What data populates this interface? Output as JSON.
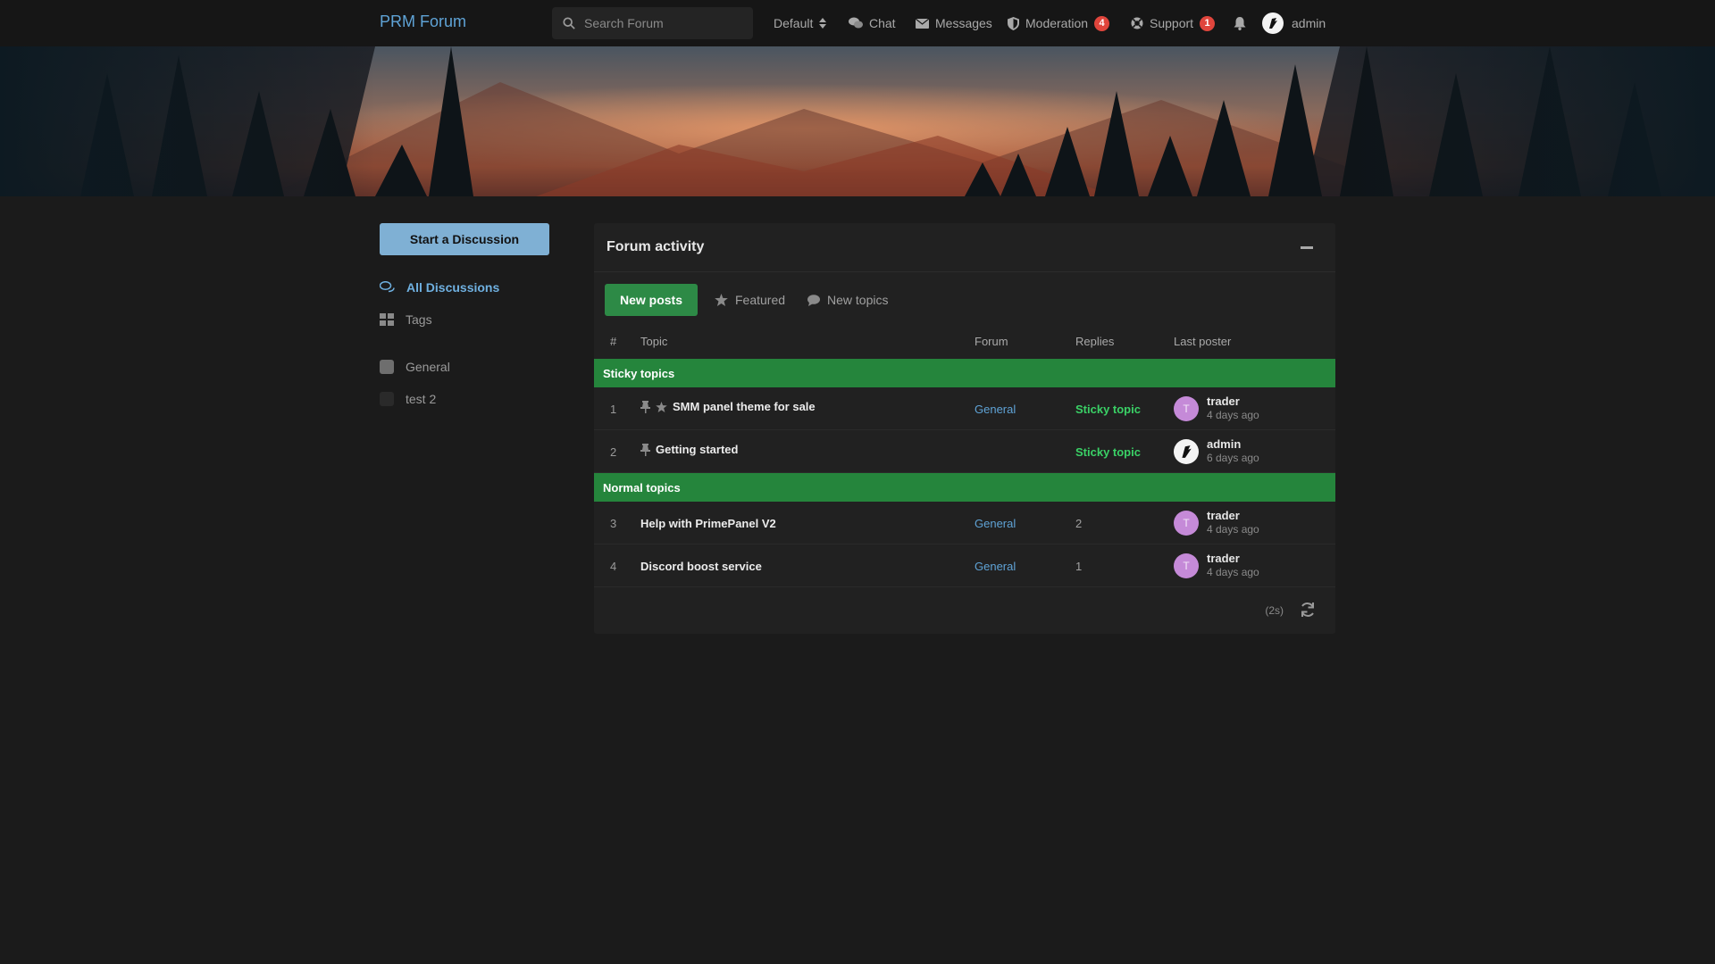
{
  "header": {
    "brand": "PRM Forum",
    "search_placeholder": "Search Forum",
    "nav": {
      "default_label": "Default",
      "chat_label": "Chat",
      "messages_label": "Messages",
      "moderation_label": "Moderation",
      "moderation_badge": "4",
      "support_label": "Support",
      "support_badge": "1",
      "user_label": "admin"
    }
  },
  "sidebar": {
    "start_button": "Start a Discussion",
    "all_discussions": "All Discussions",
    "tags": "Tags",
    "tag_items": [
      {
        "label": "General",
        "color": "#6e6e6e"
      },
      {
        "label": "test 2",
        "color": "#2a2a2a"
      }
    ]
  },
  "panel": {
    "title": "Forum activity",
    "tabs": {
      "new_posts": "New posts",
      "featured": "Featured",
      "new_topics": "New topics"
    },
    "columns": {
      "num": "#",
      "topic": "Topic",
      "forum": "Forum",
      "replies": "Replies",
      "last_poster": "Last poster"
    },
    "sticky_header": "Sticky topics",
    "normal_header": "Normal topics",
    "sticky_rows": [
      {
        "num": "1",
        "title": "SMM panel theme for sale",
        "forum": "General",
        "status": "Sticky topic",
        "poster": "trader",
        "poster_initial": "T",
        "time": "4 days ago"
      },
      {
        "num": "2",
        "title": "Getting started",
        "forum": "",
        "status": "Sticky topic",
        "poster": "admin",
        "poster_initial": "",
        "time": "6 days ago"
      }
    ],
    "normal_rows": [
      {
        "num": "3",
        "title": "Help with PrimePanel V2",
        "forum": "General",
        "replies": "2",
        "poster": "trader",
        "poster_initial": "T",
        "time": "4 days ago"
      },
      {
        "num": "4",
        "title": "Discord boost service",
        "forum": "General",
        "replies": "1",
        "poster": "trader",
        "poster_initial": "T",
        "time": "4 days ago"
      }
    ],
    "load_time": "(2s)"
  },
  "colors": {
    "accent": "#5fa3d6",
    "group_green": "#25853c",
    "sticky_green": "#3ad166",
    "badge_red": "#e0453c"
  }
}
